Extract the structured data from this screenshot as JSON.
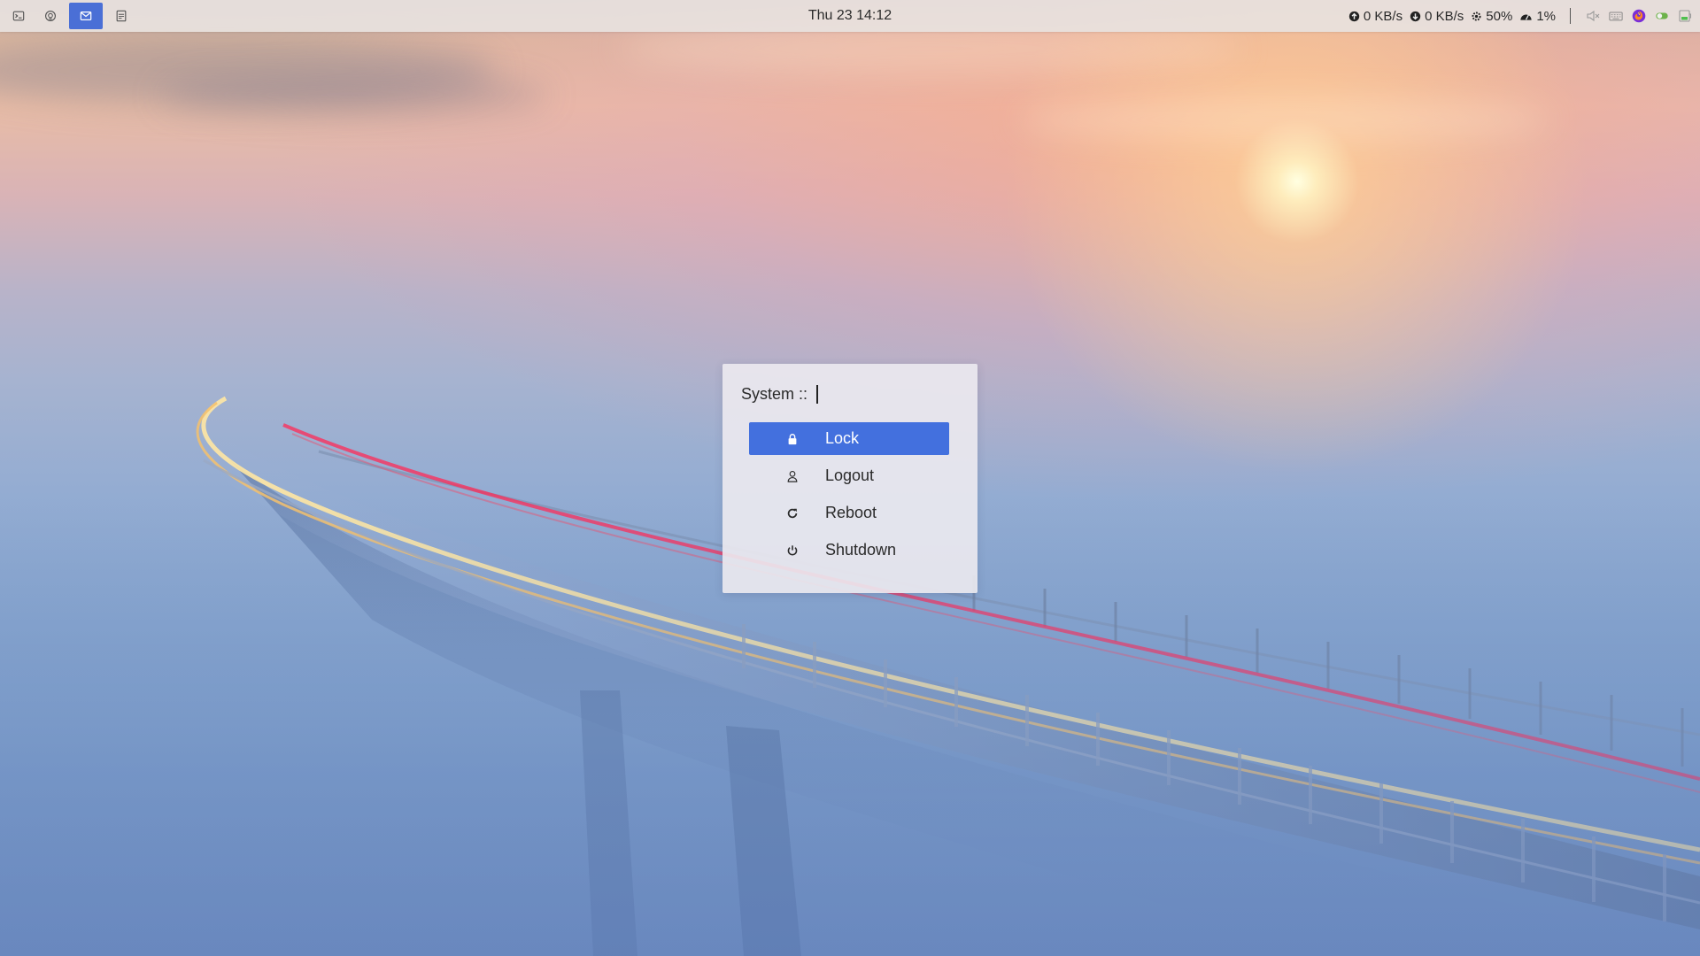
{
  "panel": {
    "workspaces": [
      {
        "icon": "terminal-icon",
        "active": false
      },
      {
        "icon": "github-icon",
        "active": false
      },
      {
        "icon": "mail-icon",
        "active": true
      },
      {
        "icon": "document-icon",
        "active": false
      }
    ],
    "clock": "Thu 23 14:12",
    "stats": {
      "upload": "0 KB/s",
      "download": "0 KB/s",
      "cpu": "50%",
      "memory": "1%"
    },
    "tray": [
      "volume-muted-icon",
      "keyboard-icon",
      "firefox-icon",
      "toggle-icon",
      "battery-icon"
    ],
    "colors": {
      "active_workspace": "#4a6fd6"
    }
  },
  "dialog": {
    "prompt": "System ::",
    "input_value": "",
    "items": [
      {
        "label": "Lock",
        "icon": "lock-icon",
        "selected": true
      },
      {
        "label": "Logout",
        "icon": "user-icon",
        "selected": false
      },
      {
        "label": "Reboot",
        "icon": "reboot-icon",
        "selected": false
      },
      {
        "label": "Shutdown",
        "icon": "power-icon",
        "selected": false
      }
    ],
    "colors": {
      "selected": "#4370de"
    }
  }
}
